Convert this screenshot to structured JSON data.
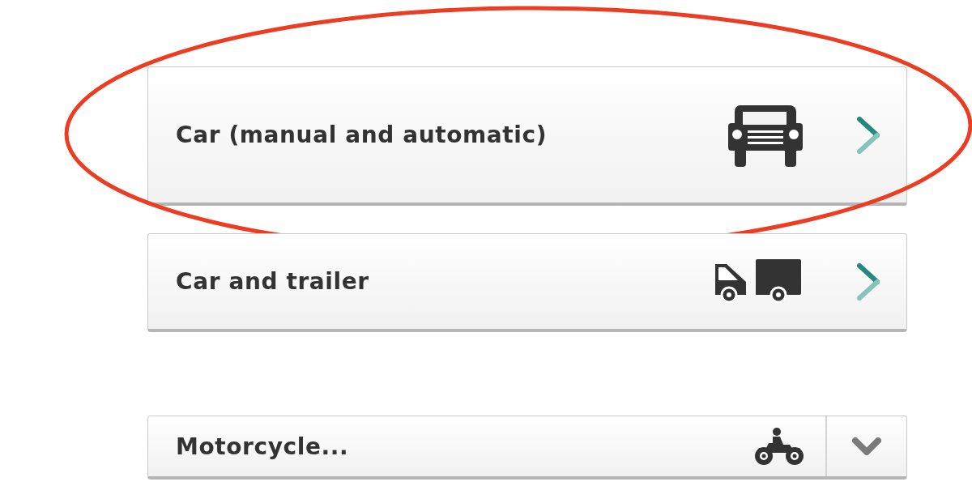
{
  "options": [
    {
      "kind": "link",
      "label": "Car (manual and automatic)",
      "circled": true
    },
    {
      "kind": "link",
      "label": "Car and trailer",
      "circled": false
    },
    {
      "kind": "dropdown",
      "label": "Motorcycle...",
      "circled": false
    }
  ]
}
